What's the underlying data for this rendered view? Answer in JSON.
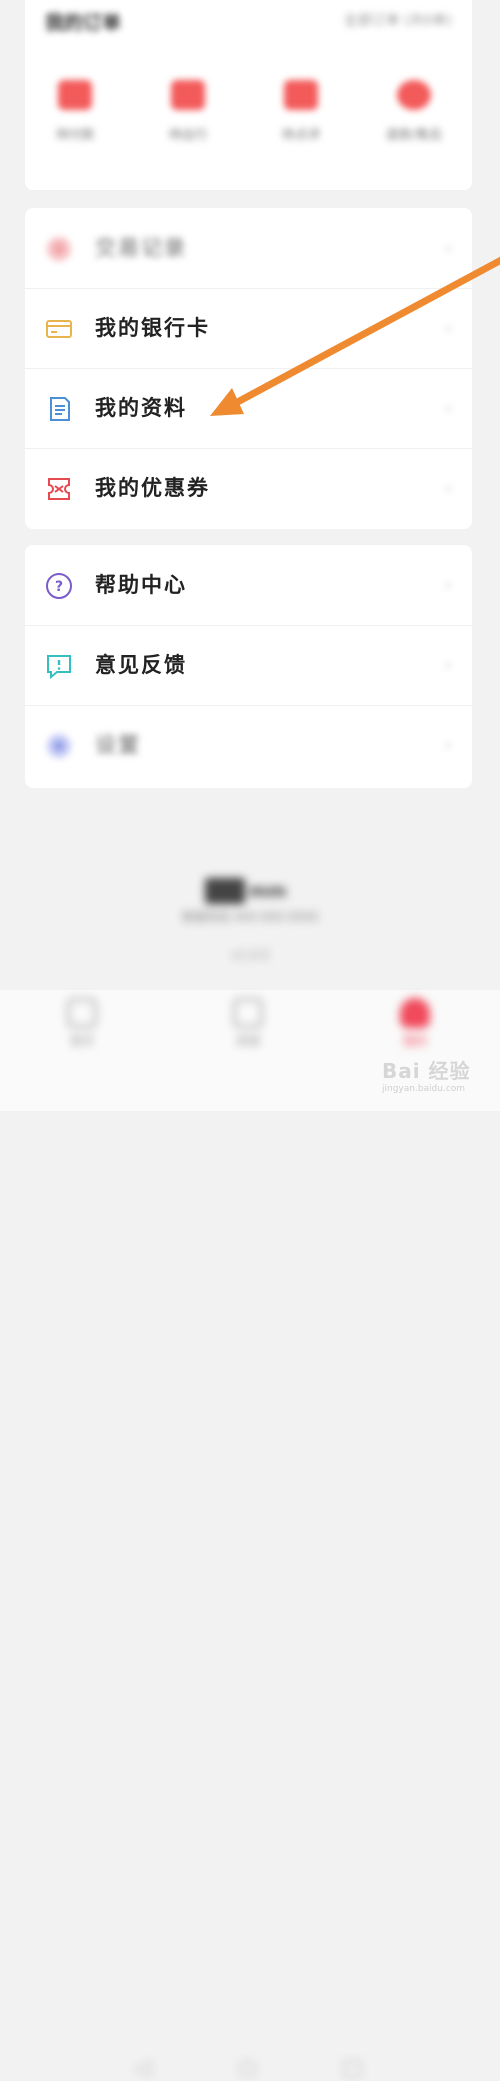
{
  "orders": {
    "title": "我的订单",
    "all_label": "全部订单 (共0单)",
    "items": [
      {
        "label": "待付款"
      },
      {
        "label": "待出行"
      },
      {
        "label": "待点评"
      },
      {
        "label": "退款/售后"
      }
    ]
  },
  "menu_section_1": [
    {
      "label": "交易记录",
      "icon": "transaction-icon"
    },
    {
      "label": "我的银行卡",
      "icon": "bank-card-icon"
    },
    {
      "label": "我的资料",
      "icon": "document-icon"
    },
    {
      "label": "我的优惠券",
      "icon": "coupon-icon"
    }
  ],
  "menu_section_2": [
    {
      "label": "帮助中心",
      "icon": "help-icon"
    },
    {
      "label": "意见反馈",
      "icon": "feedback-icon"
    },
    {
      "label": "设置",
      "icon": "settings-icon"
    }
  ],
  "footer": {
    "brand": "mm",
    "line1": "客服热线 400-000-0000",
    "line2": "v1.0.0"
  },
  "tabbar": [
    {
      "label": "首页"
    },
    {
      "label": "商城"
    },
    {
      "label": "我的"
    }
  ],
  "watermark": {
    "text": "Bai 经验",
    "sub": "jingyan.baidu.com"
  },
  "colors": {
    "accent": "#f04a5c",
    "arrow": "#f08a30"
  }
}
